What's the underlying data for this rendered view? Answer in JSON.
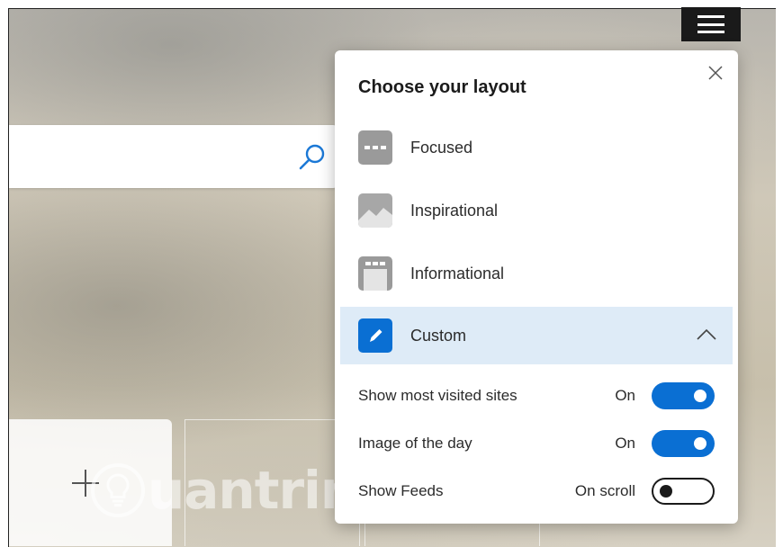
{
  "watermark": {
    "text": "uantrimang"
  },
  "panel": {
    "title": "Choose your layout",
    "layouts": [
      {
        "label": "Focused",
        "icon": "focused-layout-icon"
      },
      {
        "label": "Inspirational",
        "icon": "inspirational-layout-icon"
      },
      {
        "label": "Informational",
        "icon": "informational-layout-icon"
      },
      {
        "label": "Custom",
        "icon": "pencil-icon",
        "selected": true,
        "expanded": true
      }
    ],
    "settings": [
      {
        "label": "Show most visited sites",
        "state": "On",
        "enabled": true
      },
      {
        "label": "Image of the day",
        "state": "On",
        "enabled": true
      },
      {
        "label": "Show Feeds",
        "state": "On scroll",
        "enabled": false
      }
    ]
  },
  "colors": {
    "accent": "#0a6fd3",
    "selected_bg": "#deebf7",
    "menu_button_bg": "#1a1a1a",
    "layout_icon_gray": "#9a9a9a"
  }
}
